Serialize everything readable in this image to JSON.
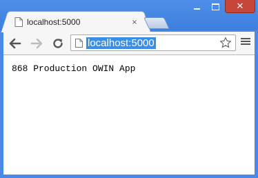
{
  "browser": {
    "tab": {
      "title": "localhost:5000",
      "close_glyph": "×"
    },
    "window_controls": {
      "close_glyph": "✕"
    },
    "toolbar": {
      "address": "localhost:5000",
      "back_icon": "arrow-left-icon",
      "forward_icon": "arrow-right-icon",
      "reload_icon": "reload-icon",
      "bookmark_icon": "star-icon",
      "menu_icon": "hamburger-icon"
    },
    "colors": {
      "frame": "#4a8ae6",
      "selection": "#3b8ee8",
      "close_button": "#c7463a"
    }
  },
  "page": {
    "body_text": "868 Production OWIN App"
  }
}
